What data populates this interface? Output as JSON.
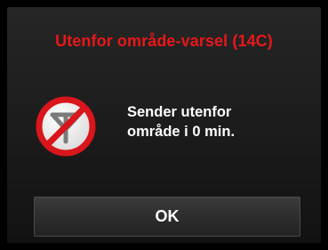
{
  "dialog": {
    "title": "Utenfor område-varsel (14C)",
    "message_line1": "Sender utenfor",
    "message_line2": "område i 0 min.",
    "ok_label": "OK",
    "icon": "no-signal-prohibited-icon"
  },
  "colors": {
    "title": "#e8171a",
    "background": "#000000",
    "prohibited_ring": "#d8161b",
    "icon_disc": "#ffffff",
    "antenna": "#7a7a7a"
  }
}
